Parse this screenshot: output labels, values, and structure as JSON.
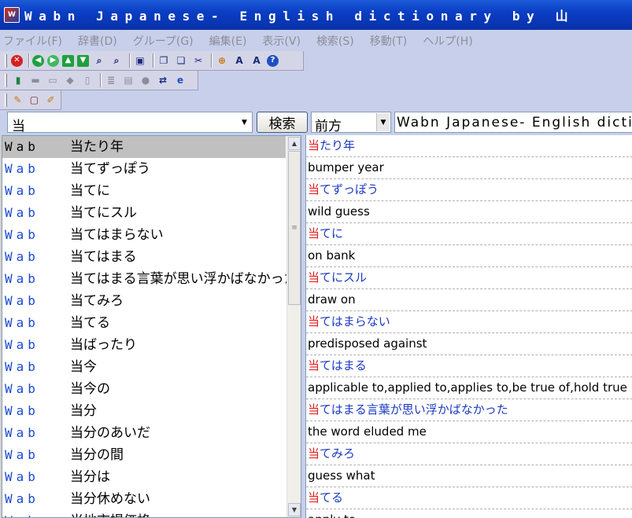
{
  "window": {
    "title": "Wabn Japanese- English dictionary by 山",
    "icon_text": "W"
  },
  "menu": [
    "ファイル(F)",
    "辞書(D)",
    "グループ(G)",
    "編集(E)",
    "表示(V)",
    "検索(S)",
    "移動(T)",
    "ヘルプ(H)"
  ],
  "toolbar": {
    "stop": "✕",
    "back": "◀",
    "forward": "▶",
    "up": "▲",
    "down": "▼",
    "find": "⌕",
    "find_next": "⌕",
    "fit": "▣",
    "copy": "❐",
    "paste": "❏",
    "cut": "✂",
    "zoom": "⊕",
    "font_up": "A",
    "font_down": "A",
    "help": "?",
    "row2": [
      "▮",
      "▬",
      "▭",
      "◆",
      "▯",
      "≣",
      "▤",
      "●",
      "⇄",
      "e"
    ],
    "row3": [
      "✎",
      "▢",
      "✐"
    ]
  },
  "search": {
    "value": "当",
    "button_label": "検索",
    "direction": "前方",
    "dictionary": "Wabn Japanese- English dictionary"
  },
  "word_list": {
    "dict_tag": "Wab",
    "items": [
      "当たり年",
      "当てずっぽう",
      "当てに",
      "当てにスル",
      "当てはまらない",
      "当てはまる",
      "当てはまる言葉が思い浮かばなかった",
      "当てみろ",
      "当てる",
      "当ばったり",
      "当今",
      "当今の",
      "当分",
      "当分のあいだ",
      "当分の間",
      "当分は",
      "当分休めない",
      "当地市場価格"
    ]
  },
  "definitions": [
    {
      "hl": "当",
      "rest": "たり年",
      "kind": "head"
    },
    {
      "text": "bumper year",
      "kind": "meaning"
    },
    {
      "hl": "当",
      "rest": "てずっぽう",
      "kind": "head"
    },
    {
      "text": "wild guess",
      "kind": "meaning"
    },
    {
      "hl": "当",
      "rest": "てに",
      "kind": "head"
    },
    {
      "text": "on bank",
      "kind": "meaning"
    },
    {
      "hl": "当",
      "rest": "てにスル",
      "kind": "head"
    },
    {
      "text": "draw on",
      "kind": "meaning"
    },
    {
      "hl": "当",
      "rest": "てはまらない",
      "kind": "head"
    },
    {
      "text": "predisposed against",
      "kind": "meaning"
    },
    {
      "hl": "当",
      "rest": "てはまる",
      "kind": "head"
    },
    {
      "text": "applicable to,applied to,applies to,be true of,hold true",
      "kind": "meaning"
    },
    {
      "hl": "当",
      "rest": "てはまる言葉が思い浮かばなかった",
      "kind": "head"
    },
    {
      "text": "the word eluded me",
      "kind": "meaning"
    },
    {
      "hl": "当",
      "rest": "てみろ",
      "kind": "head"
    },
    {
      "text": "guess what",
      "kind": "meaning"
    },
    {
      "hl": "当",
      "rest": "てる",
      "kind": "head"
    },
    {
      "text": "apply to",
      "kind": "meaning"
    }
  ]
}
